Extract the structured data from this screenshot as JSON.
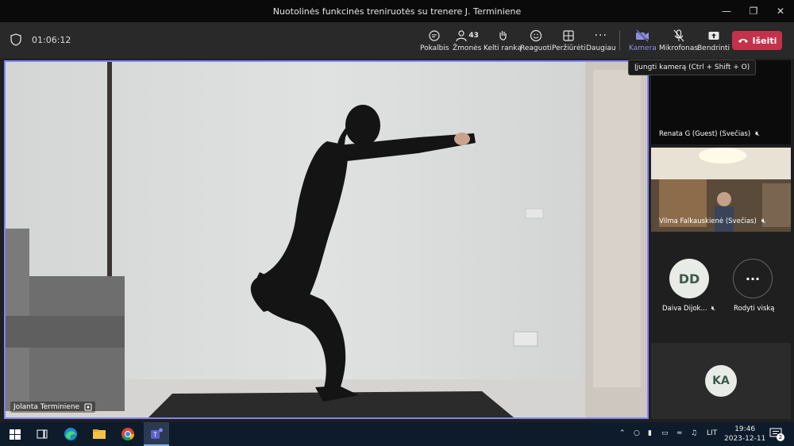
{
  "window": {
    "title": "Nuotolinės funkcinės treniruotės su trenere J. Terminiene"
  },
  "toolbar": {
    "timer": "01:06:12",
    "buttons": {
      "chat": "Pokalbis",
      "people": "Žmonės",
      "people_count": "43",
      "raise_hand": "Kelti ranką",
      "react": "Reaguoti",
      "view": "Peržiūrėti",
      "more": "Daugiau",
      "camera": "Kamera",
      "mic": "Mikrofonas",
      "share": "Bendrinti"
    },
    "leave_label": "Išeiti",
    "tooltip": "Įjungti kamerą (Ctrl + Shift + O)"
  },
  "main_video": {
    "name": "Jolanta Terminiene"
  },
  "participants": {
    "tile1": {
      "name": "Renata G (Guest) (Svečias)"
    },
    "tile2": {
      "name": "Vilma Falkauskienė (Svečias)"
    },
    "avatar_dd": {
      "initials": "DD",
      "name": "Daiva Dijok..."
    },
    "show_all": {
      "label": "Rodyti viską"
    },
    "avatar_ka": {
      "initials": "KA"
    }
  },
  "taskbar": {
    "language": "LIT",
    "time": "19:46",
    "date": "2023-12-11",
    "notifications": "2"
  },
  "colors": {
    "accent": "#7f85f5",
    "leave": "#c4314b",
    "avatar_bg": "#e8ebe6",
    "avatar_text": "#3b5b4a"
  }
}
